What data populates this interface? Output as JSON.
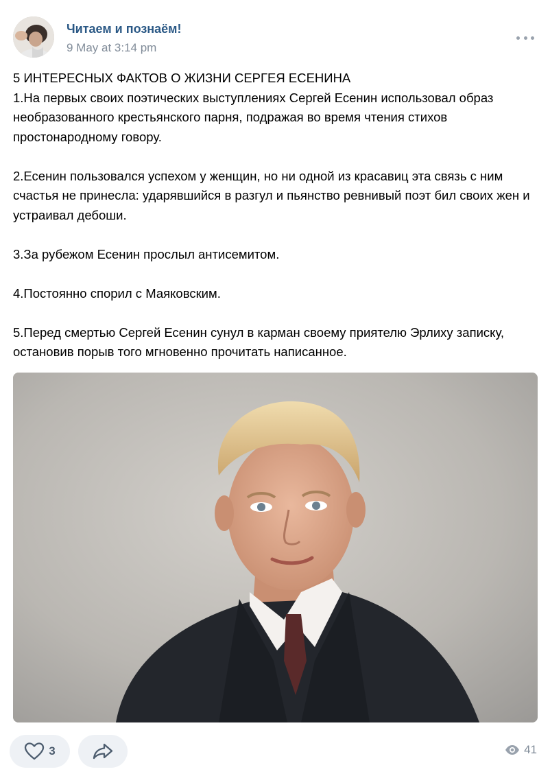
{
  "post": {
    "author": "Читаем и познаём!",
    "date": "9 May at 3:14 pm",
    "paragraphs": [
      "5 ИНТЕРЕСНЫХ ФАКТОВ О ЖИЗНИ СЕРГЕЯ ЕСЕНИНА",
      "1.На первых своих поэтических выступлениях Сергей Есенин использовал образ необразованного крестьянского парня, подражая во время чтения стихов простонародному говору.",
      "",
      "2.Есенин пользовался успехом у женщин, но ни одной из красавиц эта связь с ним счастья не принесла: ударявшийся в разгул и пьянство ревнивый поэт бил своих жен и устраивал дебоши.",
      "",
      "3.За рубежом Есенин прослыл антисемитом.",
      "",
      "4.Постоянно спорил с Маяковским.",
      "",
      "5.Перед смертью Сергей Есенин сунул в карман своему приятелю Эрлиху записку, остановив порыв того мгновенно прочитать написанное."
    ]
  },
  "footer": {
    "likes": "3",
    "views": "41"
  },
  "colors": {
    "author_link": "#2a5885",
    "muted": "#818c99",
    "button_bg": "#eef1f5",
    "icon": "#99a2ad"
  },
  "icons": {
    "more": "more-horizontal-icon",
    "like": "heart-outline-icon",
    "share": "share-arrow-icon",
    "views": "eye-icon"
  }
}
